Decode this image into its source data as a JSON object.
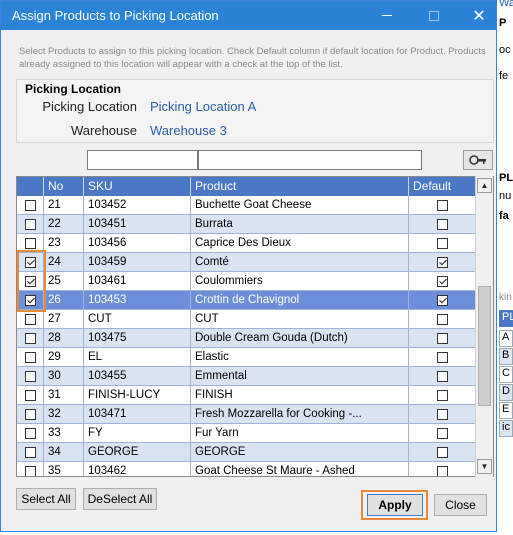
{
  "dialog": {
    "title": "Assign Products to Picking Location",
    "close_glyph": "✕",
    "instructions": "Select Products to assign to this picking location. Check Default column if default location for Product. Products already assigned to this location will appear with a check at the top of the list."
  },
  "location": {
    "heading": "Picking Location",
    "picking_label": "Picking Location",
    "picking_value": "Picking Location A",
    "warehouse_label": "Warehouse",
    "warehouse_value": "Warehouse 3"
  },
  "grid": {
    "columns": [
      "No",
      "SKU",
      "Product",
      "Default"
    ],
    "rows": [
      {
        "checked": false,
        "no": "21",
        "sku": "103452",
        "product": "Buchette Goat Cheese",
        "default": false,
        "selected": false
      },
      {
        "checked": false,
        "no": "22",
        "sku": "103451",
        "product": "Burrata",
        "default": false,
        "selected": false
      },
      {
        "checked": false,
        "no": "23",
        "sku": "103456",
        "product": "Caprice Des Dieux",
        "default": false,
        "selected": false
      },
      {
        "checked": true,
        "no": "24",
        "sku": "103459",
        "product": "Comté",
        "default": true,
        "selected": false
      },
      {
        "checked": true,
        "no": "25",
        "sku": "103461",
        "product": "Coulommiers",
        "default": true,
        "selected": false
      },
      {
        "checked": true,
        "no": "26",
        "sku": "103453",
        "product": "Crottin de Chavignol",
        "default": true,
        "selected": true
      },
      {
        "checked": false,
        "no": "27",
        "sku": "CUT",
        "product": "CUT",
        "default": false,
        "selected": false
      },
      {
        "checked": false,
        "no": "28",
        "sku": "103475",
        "product": "Double Cream Gouda (Dutch)",
        "default": false,
        "selected": false
      },
      {
        "checked": false,
        "no": "29",
        "sku": "EL",
        "product": "Elastic",
        "default": false,
        "selected": false
      },
      {
        "checked": false,
        "no": "30",
        "sku": "103455",
        "product": "Emmental",
        "default": false,
        "selected": false
      },
      {
        "checked": false,
        "no": "31",
        "sku": "FINISH-LUCY",
        "product": "FINISH",
        "default": false,
        "selected": false
      },
      {
        "checked": false,
        "no": "32",
        "sku": "103471",
        "product": "Fresh Mozzarella for Cooking -...",
        "default": false,
        "selected": false
      },
      {
        "checked": false,
        "no": "33",
        "sku": "FY",
        "product": "Fur Yarn",
        "default": false,
        "selected": false
      },
      {
        "checked": false,
        "no": "34",
        "sku": "GEORGE",
        "product": "GEORGE",
        "default": false,
        "selected": false
      },
      {
        "checked": false,
        "no": "35",
        "sku": "103462",
        "product": "Goat Cheese St Maure - Ashed",
        "default": false,
        "selected": false
      }
    ]
  },
  "buttons": {
    "select_all": "Select All",
    "deselect_all": "DeSelect All",
    "apply": "Apply",
    "close": "Close"
  },
  "icons": {
    "search": "search-icon",
    "minimize": "minimize-icon",
    "maximize": "maximize-icon",
    "close": "close-icon",
    "scroll_up": "▲",
    "scroll_down": "▼"
  },
  "background_window": {
    "fragments": [
      "Wareho",
      "P",
      "oc",
      "fe",
      "PL",
      "nu",
      "fa",
      "kin",
      "PL",
      "A",
      "B",
      "C",
      "D",
      "E",
      "ic"
    ]
  },
  "colors": {
    "titlebar": "#2b83d8",
    "grid_header": "#4a78c4",
    "row_alt": "#dae3f2",
    "row_selected": "#6b8fd8",
    "highlight": "#e8893a",
    "link_value": "#2b5ea7"
  }
}
